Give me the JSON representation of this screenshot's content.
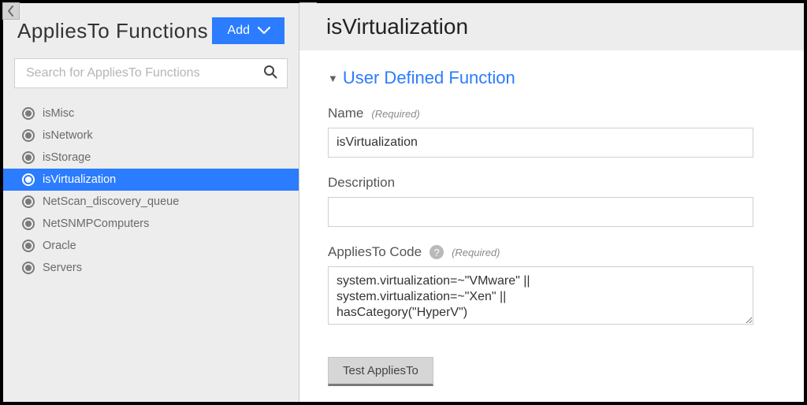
{
  "sidebar": {
    "title": "AppliesTo Functions",
    "add_label": "Add",
    "search_placeholder": "Search for AppliesTo Functions",
    "items": [
      {
        "label": "isMisc",
        "selected": false
      },
      {
        "label": "isNetwork",
        "selected": false
      },
      {
        "label": "isStorage",
        "selected": false
      },
      {
        "label": "isVirtualization",
        "selected": true
      },
      {
        "label": "NetScan_discovery_queue",
        "selected": false
      },
      {
        "label": "NetSNMPComputers",
        "selected": false
      },
      {
        "label": "Oracle",
        "selected": false
      },
      {
        "label": "Servers",
        "selected": false
      }
    ]
  },
  "main": {
    "title": "isVirtualization",
    "section_title": "User Defined Function",
    "fields": {
      "name": {
        "label": "Name",
        "required_text": "(Required)",
        "value": "isVirtualization"
      },
      "description": {
        "label": "Description",
        "value": ""
      },
      "code": {
        "label": "AppliesTo Code",
        "required_text": "(Required)",
        "value": "system.virtualization=~\"VMware\" ||\nsystem.virtualization=~\"Xen\" ||\nhasCategory(\"HyperV\")"
      }
    },
    "test_button_label": "Test AppliesTo"
  }
}
